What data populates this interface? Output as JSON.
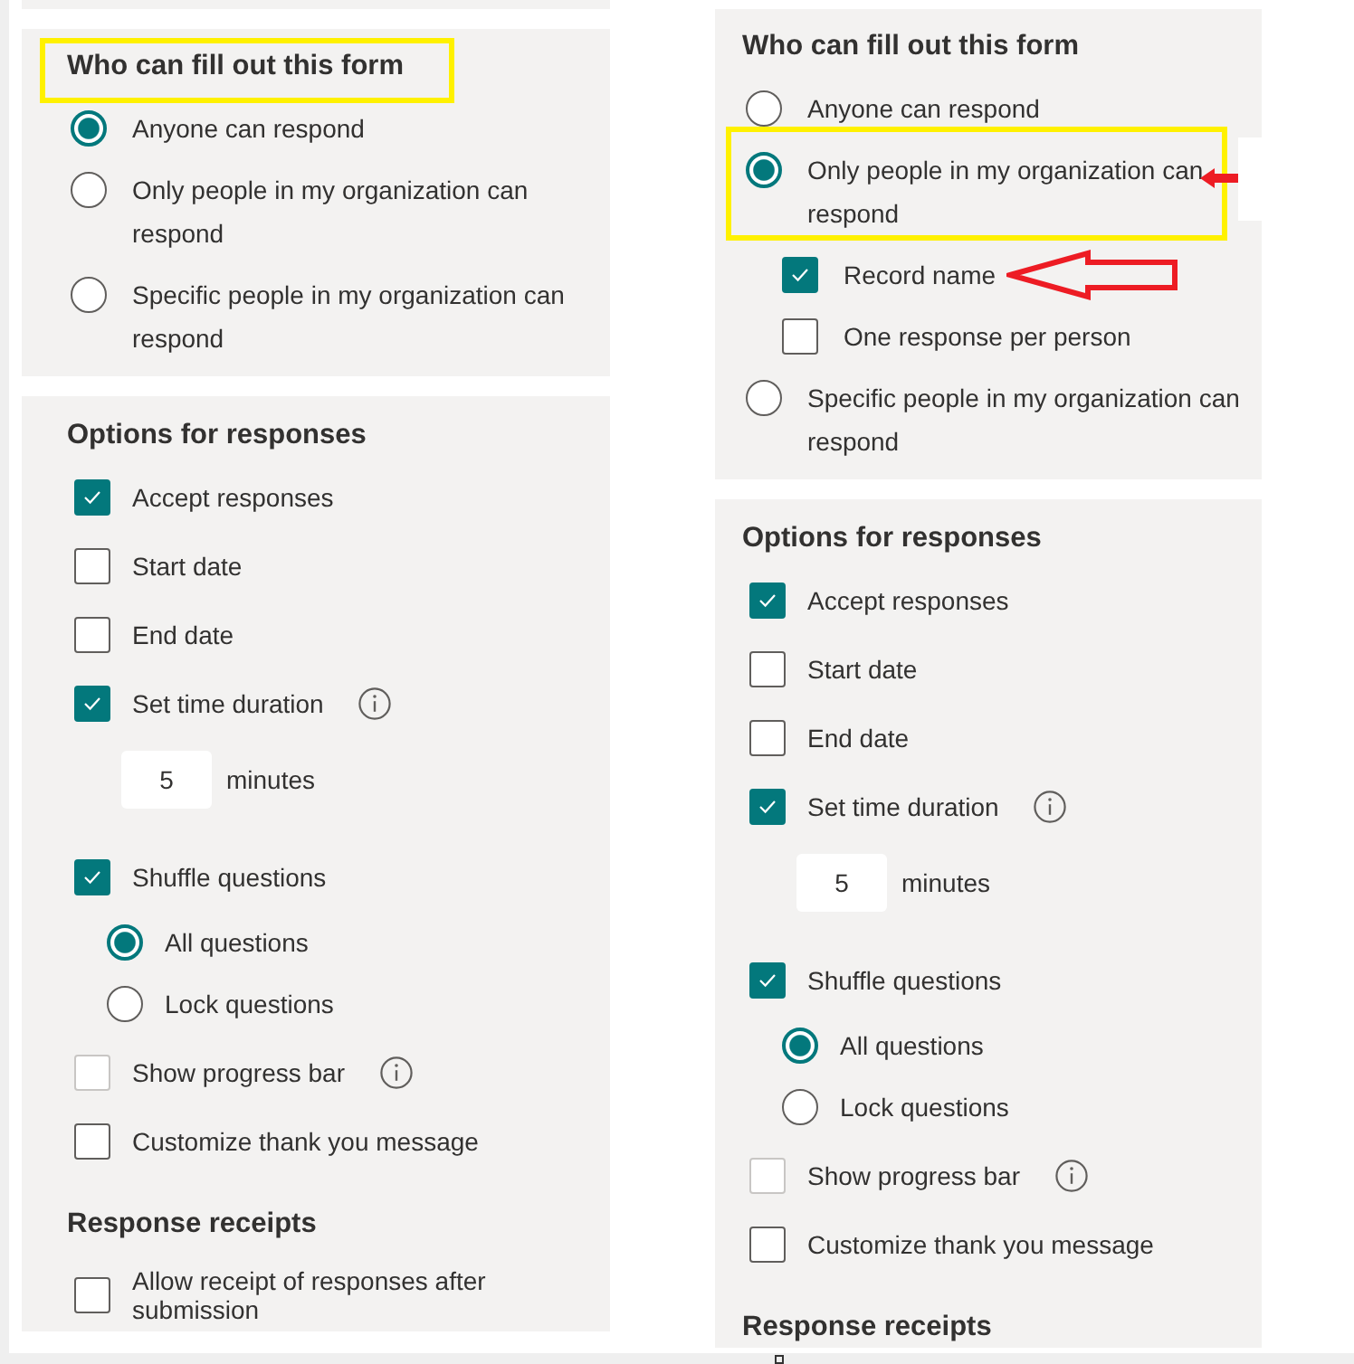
{
  "views": [
    {
      "who": {
        "heading": {
          "text": "Who can fill out this form",
          "highlighted": true
        },
        "options": [
          {
            "label": "Anyone can respond",
            "selected": true,
            "highlighted": false
          },
          {
            "label": "Only people in my organization can respond",
            "selected": false,
            "highlighted": false
          },
          {
            "label": "Specific people in my organization can respond",
            "selected": false,
            "highlighted": false
          }
        ]
      },
      "responses": {
        "heading": "Options for responses",
        "items": [
          {
            "kind": "checkbox",
            "label": "Accept responses",
            "checked": true,
            "disabled": false
          },
          {
            "kind": "checkbox",
            "label": "Start date",
            "checked": false,
            "disabled": false
          },
          {
            "kind": "checkbox",
            "label": "End date",
            "checked": false,
            "disabled": false
          },
          {
            "kind": "checkbox",
            "label": "Set time duration",
            "checked": true,
            "disabled": false,
            "info": true
          },
          {
            "kind": "duration",
            "value": "5",
            "unit": "minutes"
          },
          {
            "kind": "checkbox",
            "label": "Shuffle questions",
            "checked": true,
            "disabled": false,
            "children": [
              {
                "label": "All questions",
                "selected": true
              },
              {
                "label": "Lock questions",
                "selected": false
              }
            ]
          },
          {
            "kind": "checkbox",
            "label": "Show progress bar",
            "checked": false,
            "disabled": true,
            "info": true
          },
          {
            "kind": "checkbox",
            "label": "Customize thank you message",
            "checked": false,
            "disabled": false
          }
        ]
      },
      "receipts": {
        "heading": "Response receipts",
        "items": [
          {
            "kind": "checkbox",
            "label": "Allow receipt of responses after submission",
            "checked": false,
            "disabled": false
          }
        ]
      }
    },
    {
      "who": {
        "heading": {
          "text": "Who can fill out this form",
          "highlighted": false
        },
        "options": [
          {
            "label": "Anyone can respond",
            "selected": false,
            "highlighted": false
          },
          {
            "label": "Only people in my organization can respond",
            "selected": true,
            "highlighted": true,
            "arrow": true,
            "children": [
              {
                "label": "Record name",
                "checked": true,
                "disabled": false,
                "arrow": true
              },
              {
                "label": "One response per person",
                "checked": false,
                "disabled": false
              }
            ]
          },
          {
            "label": "Specific people in my organization can respond",
            "selected": false,
            "highlighted": false
          }
        ]
      },
      "responses": {
        "heading": "Options for responses",
        "items": [
          {
            "kind": "checkbox",
            "label": "Accept responses",
            "checked": true,
            "disabled": false
          },
          {
            "kind": "checkbox",
            "label": "Start date",
            "checked": false,
            "disabled": false
          },
          {
            "kind": "checkbox",
            "label": "End date",
            "checked": false,
            "disabled": false
          },
          {
            "kind": "checkbox",
            "label": "Set time duration",
            "checked": true,
            "disabled": false,
            "info": true
          },
          {
            "kind": "duration",
            "value": "5",
            "unit": "minutes"
          },
          {
            "kind": "checkbox",
            "label": "Shuffle questions",
            "checked": true,
            "disabled": false,
            "children": [
              {
                "label": "All questions",
                "selected": true
              },
              {
                "label": "Lock questions",
                "selected": false
              }
            ]
          },
          {
            "kind": "checkbox",
            "label": "Show progress bar",
            "checked": false,
            "disabled": true,
            "info": true
          },
          {
            "kind": "checkbox",
            "label": "Customize thank you message",
            "checked": false,
            "disabled": false
          }
        ]
      },
      "receipts": {
        "heading": "Response receipts"
      }
    }
  ]
}
